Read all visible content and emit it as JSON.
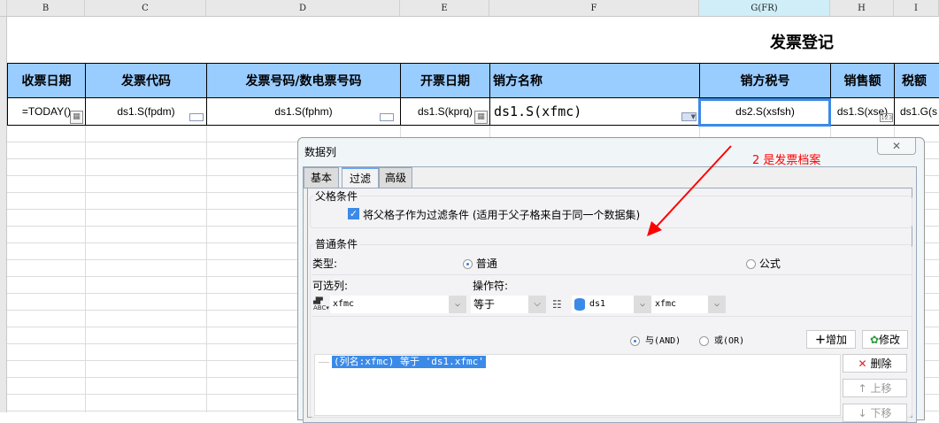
{
  "sheet": {
    "columns": [
      {
        "id": "B"
      },
      {
        "id": "C"
      },
      {
        "id": "D"
      },
      {
        "id": "E"
      },
      {
        "id": "F"
      },
      {
        "id": "G(FR)"
      },
      {
        "id": "H"
      },
      {
        "id": "I"
      }
    ],
    "title": "发票登记",
    "headers": [
      "收票日期",
      "发票代码",
      "发票号码/数电票号码",
      "开票日期",
      "销方名称",
      "销方税号",
      "销售额",
      "税额"
    ],
    "cells": [
      "=TODAY()",
      "ds1.S(fpdm)",
      "ds1.S(fphm)",
      "ds1.S(kprq)",
      "ds1.S(xfmc)",
      "ds2.S(xsfsh)",
      "ds1.S(xse)",
      "ds1.G(s"
    ]
  },
  "annotation": {
    "text": "2 是发票档案",
    "color": "#ff0000"
  },
  "dialog": {
    "title": "数据列",
    "close": "✕",
    "tabs": [
      "基本",
      "过滤",
      "高级"
    ],
    "parent_group": "父格条件",
    "parent_checkbox": "将父格子作为过滤条件 (适用于父子格来自于同一个数据集)",
    "normal_group": "普通条件",
    "type_label": "类型:",
    "type_normal": "普通",
    "type_formula": "公式",
    "column_label": "可选列:",
    "operator_label": "操作符:",
    "column_value": "xfmc",
    "operator_value": "等于",
    "dataset_value": "ds1",
    "field_value": "xfmc",
    "and_label": "与(AND)",
    "or_label": "或(OR)",
    "add_button": "增加",
    "modify_button": "修改",
    "delete_button": "删除",
    "up_button": "上移",
    "down_button": "下移",
    "condition": "(列名:xfmc) 等于 'ds1.xfmc'"
  }
}
